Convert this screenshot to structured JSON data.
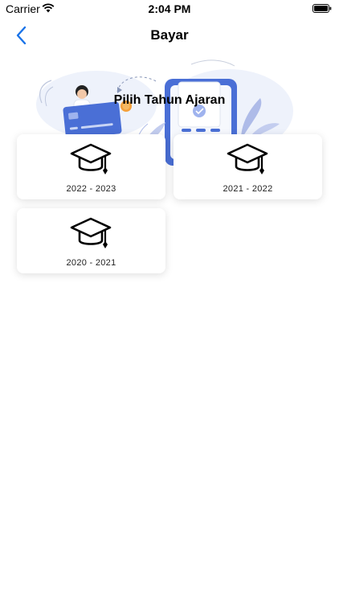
{
  "status_bar": {
    "carrier": "Carrier",
    "time": "2:04 PM"
  },
  "nav": {
    "title": "Bayar",
    "back_icon": "chevron-left-icon",
    "accent_color": "#1a73e8"
  },
  "hero": {
    "title": "Pilih Tahun Ajaran",
    "illustration": "payment-illustration"
  },
  "years": [
    {
      "label": "2022 - 2023",
      "icon": "graduation-cap-icon"
    },
    {
      "label": "2021 - 2022",
      "icon": "graduation-cap-icon"
    },
    {
      "label": "2020 - 2021",
      "icon": "graduation-cap-icon"
    }
  ],
  "colors": {
    "illustration_blue": "#4a6fd6",
    "illustration_light": "#e8eefb",
    "coin": "#f5a03a"
  }
}
